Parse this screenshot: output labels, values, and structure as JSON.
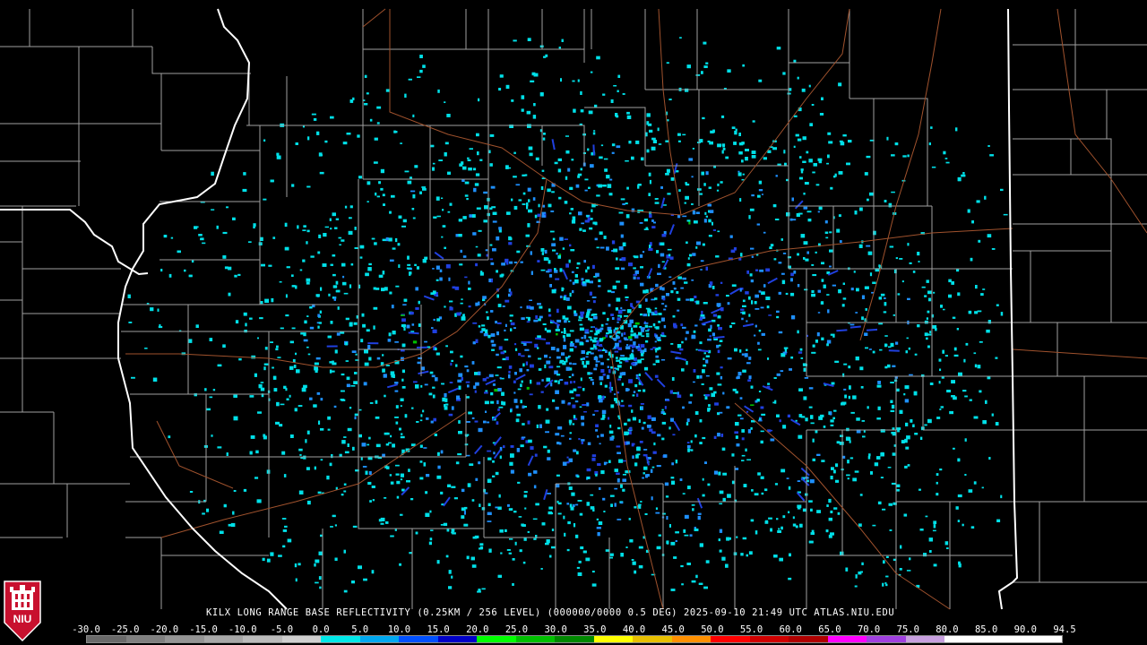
{
  "caption": "KILX LONG RANGE BASE REFLECTIVITY (0.25KM / 256 LEVEL) (000000/0000 0.5 DEG) 2025-09-10 21:49 UTC  ATLAS.NIU.EDU",
  "logo_text": "NIU",
  "scale": {
    "labels": [
      "-30.0",
      "-25.0",
      "-20.0",
      "-15.0",
      "-10.0",
      "-5.0",
      "0.0",
      "5.0",
      "10.0",
      "15.0",
      "20.0",
      "25.0",
      "30.0",
      "35.0",
      "40.0",
      "45.0",
      "50.0",
      "55.0",
      "60.0",
      "65.0",
      "70.0",
      "75.0",
      "80.0",
      "85.0",
      "90.0",
      "94.5"
    ],
    "colors": [
      "#6a6a6a",
      "#808080",
      "#959595",
      "#a8a8a8",
      "#bcbcbc",
      "#d0d0d0",
      "#00e8e8",
      "#00a8f0",
      "#0050ff",
      "#0000c8",
      "#00ff00",
      "#00c000",
      "#008800",
      "#ffff00",
      "#e8c000",
      "#ff9000",
      "#ff0000",
      "#d00000",
      "#b00000",
      "#ff00ff",
      "#a040e0",
      "#c8a0e0",
      "#ffffff",
      "#ffffff",
      "#ffffff"
    ]
  },
  "colors": {
    "background": "#000000",
    "county_lines": "#a0a0a0",
    "state_lines": "#ffffff",
    "highways": "#a0522d",
    "echo_light": "#00e0e8",
    "echo_mid": "#1e90ff",
    "echo_dense": "#2040e0",
    "echo_green": "#00c000"
  },
  "radar": {
    "site": "KILX",
    "product": "Base Reflectivity"
  }
}
